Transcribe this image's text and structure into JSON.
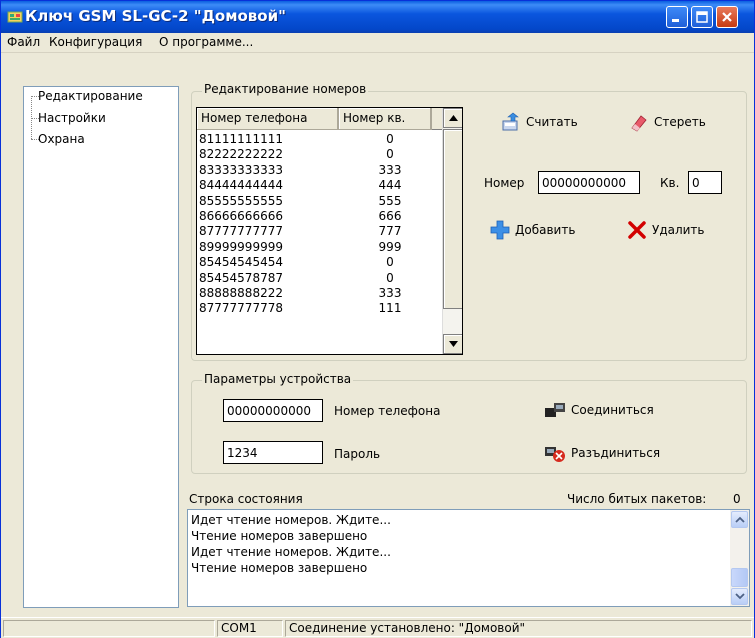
{
  "window": {
    "title": "Ключ GSM SL-GC-2 \"Домовой\""
  },
  "menu": [
    "Файл",
    "Конфигурация",
    "О программе..."
  ],
  "tree": {
    "items": [
      "Редактирование",
      "Настройки",
      "Охрана"
    ]
  },
  "numbers_group": {
    "legend": "Редактирование номеров",
    "columns": [
      "Номер телефона",
      "Номер кв."
    ],
    "rows": [
      {
        "phone": "81111111111",
        "flat": "0"
      },
      {
        "phone": "82222222222",
        "flat": "0"
      },
      {
        "phone": "83333333333",
        "flat": "333"
      },
      {
        "phone": "84444444444",
        "flat": "444"
      },
      {
        "phone": "85555555555",
        "flat": "555"
      },
      {
        "phone": "86666666666",
        "flat": "666"
      },
      {
        "phone": "87777777777",
        "flat": "777"
      },
      {
        "phone": "89999999999",
        "flat": "999"
      },
      {
        "phone": "85454545454",
        "flat": "0"
      },
      {
        "phone": "85454578787",
        "flat": "0"
      },
      {
        "phone": "88888888222",
        "flat": "333"
      },
      {
        "phone": "87777777778",
        "flat": "111"
      }
    ],
    "read_label": "Считать",
    "erase_label": "Стереть",
    "number_label": "Номер",
    "number_value": "00000000000",
    "flat_label": "Кв.",
    "flat_value": "0",
    "add_label": "Добавить",
    "delete_label": "Удалить"
  },
  "device_group": {
    "legend": "Параметры устройства",
    "phone_value": "00000000000",
    "phone_label": "Номер телефона",
    "password_value": "1234",
    "password_label": "Пароль",
    "connect_label": "Соединиться",
    "disconnect_label": "Разъдиниться"
  },
  "status": {
    "title": "Строка состояния",
    "broken_label": "Число битых пакетов:",
    "broken_count": "0",
    "log": [
      "Идет чтение номеров. Ждите...",
      "Чтение номеров завершено",
      "Идет чтение номеров. Ждите...",
      "Чтение номеров завершено"
    ]
  },
  "statusbar": {
    "port": "COM1",
    "message": "Соединение установлено: \"Домовой\""
  },
  "colors": {
    "titlebar": "#0A5FE0",
    "window_bg": "#ECE9D8",
    "close_button": "#C63A12"
  }
}
